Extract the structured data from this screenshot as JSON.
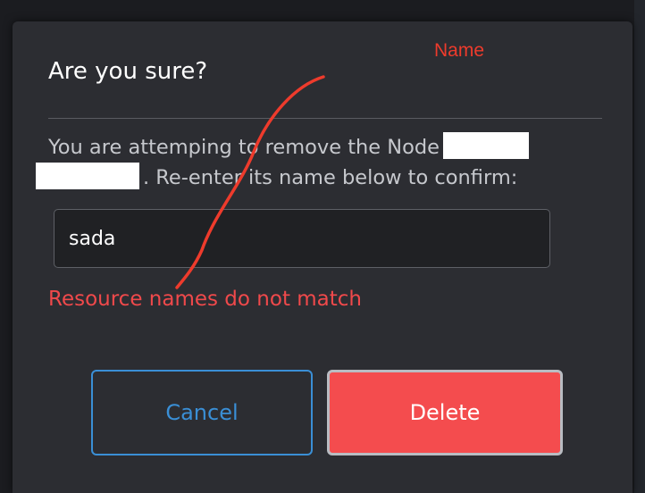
{
  "dialog": {
    "title": "Are you sure?",
    "message_part1": "You are attemping to remove the Node",
    "message_part2": ". Re-enter its name below to confirm:",
    "input_value": "sada",
    "error": "Resource names do not match",
    "cancel_label": "Cancel",
    "delete_label": "Delete"
  },
  "annotation": {
    "label": "Name"
  },
  "colors": {
    "modal_bg": "#2c2d32",
    "error": "#f0494b",
    "cancel_accent": "#3a8fd6",
    "delete_bg": "#f44c4e",
    "annotation": "#ee3b2c"
  }
}
